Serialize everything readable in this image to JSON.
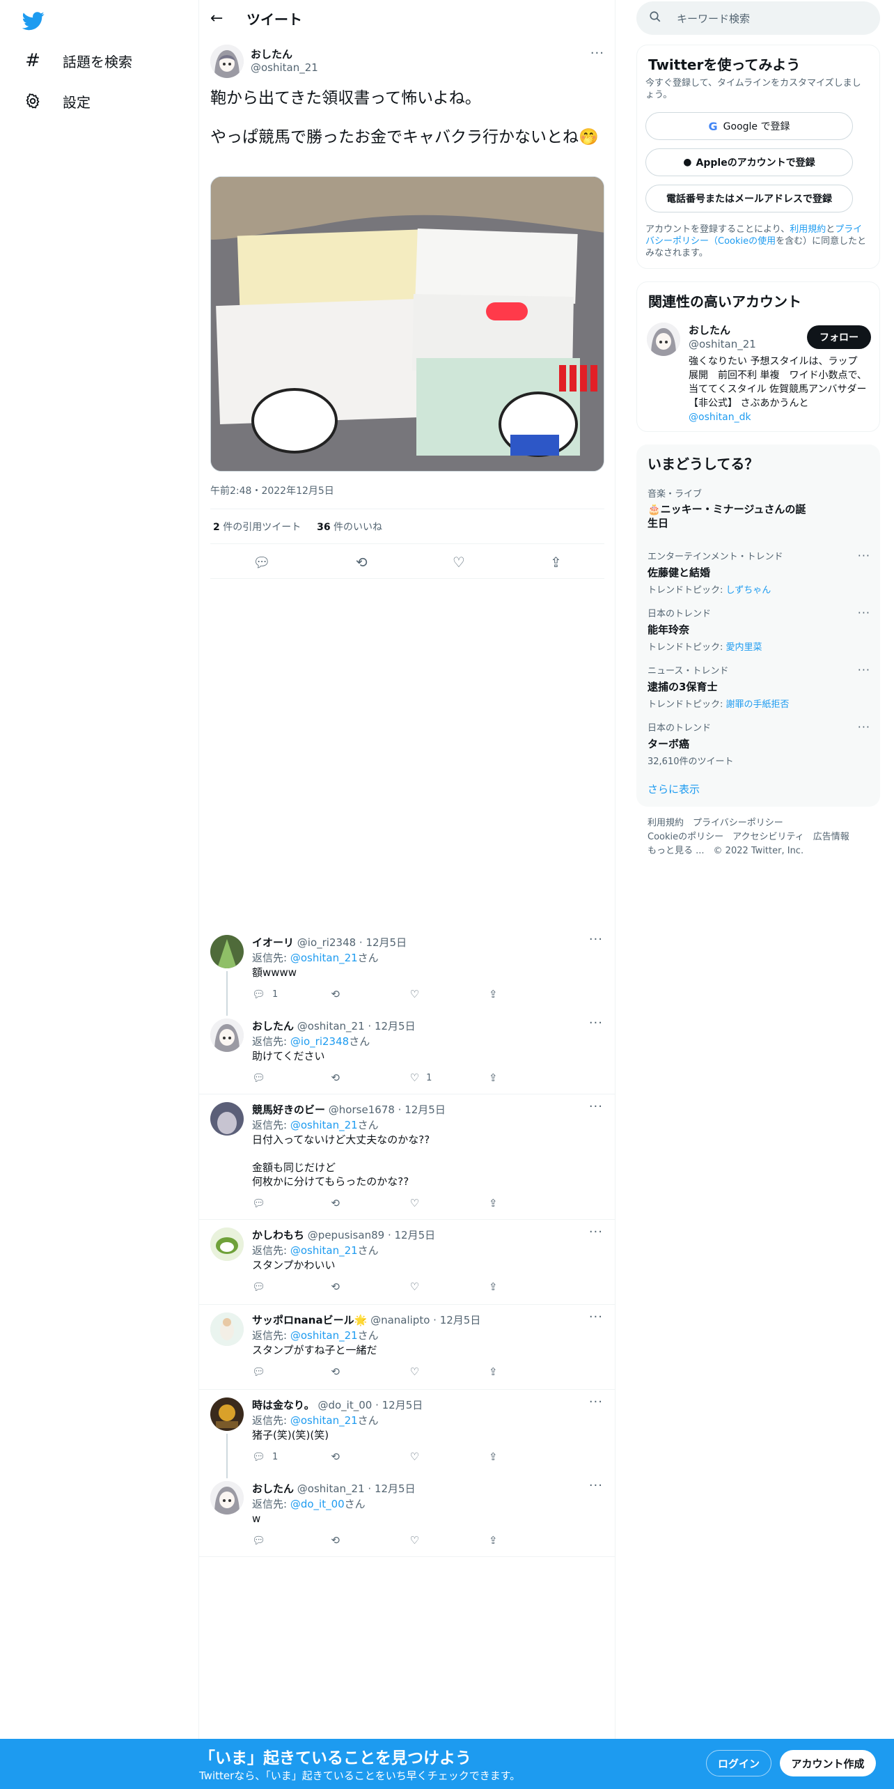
{
  "nav": {
    "logo": "twitter-bird",
    "items": [
      {
        "label": "話題を検索",
        "icon": "hashtag-icon"
      },
      {
        "label": "設定",
        "icon": "gear-icon"
      }
    ]
  },
  "header": {
    "title": "ツイート"
  },
  "tweet": {
    "name": "おしたん",
    "handle": "@oshitan_21",
    "text1": "鞄から出てきた領収書って怖いよね。",
    "text2": "やっぱ競馬で勝ったお金でキャバクラ行かないとね🤭",
    "timestamp": "午前2:48・2022年12月5日",
    "quote_count": "2",
    "quote_label": "件の引用ツイート",
    "like_count": "36",
    "like_label": "件のいいね"
  },
  "replies": [
    {
      "name": "イオーリ",
      "handle": "@io_ri2348",
      "date": "12月5日",
      "to_prefix": "返信先: ",
      "to": "@oshitan_21",
      "to_suffix": "さん",
      "text": "額wwww",
      "reply_count": "1",
      "retweet_count": "",
      "like_count": ""
    },
    {
      "name": "おしたん",
      "handle": "@oshitan_21",
      "date": "12月5日",
      "to_prefix": "返信先: ",
      "to": "@io_ri2348",
      "to_suffix": "さん",
      "text": "助けてください",
      "reply_count": "",
      "retweet_count": "",
      "like_count": "1"
    },
    {
      "name": "競馬好きのビー",
      "handle": "@horse1678",
      "date": "12月5日",
      "to_prefix": "返信先: ",
      "to": "@oshitan_21",
      "to_suffix": "さん",
      "text": "日付入ってないけど大丈夫なのかな??",
      "text2": "金額も同じだけど",
      "text3": "何枚かに分けてもらったのかな??",
      "reply_count": "",
      "retweet_count": "",
      "like_count": ""
    },
    {
      "name": "かしわもち",
      "handle": "@pepusisan89",
      "date": "12月5日",
      "to_prefix": "返信先: ",
      "to": "@oshitan_21",
      "to_suffix": "さん",
      "text": "スタンプかわいい",
      "reply_count": "",
      "retweet_count": "",
      "like_count": ""
    },
    {
      "name": "サッポロnanaビール🌟",
      "handle": "@nanalipto",
      "date": "12月5日",
      "to_prefix": "返信先: ",
      "to": "@oshitan_21",
      "to_suffix": "さん",
      "text": "スタンプがすね子と一緒だ",
      "reply_count": "",
      "retweet_count": "",
      "like_count": ""
    },
    {
      "name": "時は金なり。",
      "handle": "@do_it_00",
      "date": "12月5日",
      "to_prefix": "返信先: ",
      "to": "@oshitan_21",
      "to_suffix": "さん",
      "text": "猪子(笑)(笑)(笑)",
      "reply_count": "1",
      "retweet_count": "",
      "like_count": ""
    },
    {
      "name": "おしたん",
      "handle": "@oshitan_21",
      "date": "12月5日",
      "to_prefix": "返信先: ",
      "to": "@do_it_00",
      "to_suffix": "さん",
      "text": "w",
      "reply_count": "",
      "retweet_count": "",
      "like_count": ""
    }
  ],
  "search": {
    "placeholder": "キーワード検索"
  },
  "signup_box": {
    "title": "Twitterを使ってみよう",
    "subtitle": "今すぐ登録して、タイムラインをカスタマイズしましょう。",
    "google": "Google で登録",
    "apple": "Appleのアカウントで登録",
    "phone": "電話番号またはメールアドレスで登録",
    "terms_a": "アカウントを登録することにより、",
    "terms_link1": "利用規約",
    "terms_b": "と",
    "terms_link2": "プライバシーポリシー（Cookieの使用",
    "terms_c": "を含む）に同意したとみなされます。"
  },
  "related": {
    "title": "関連性の高いアカウント",
    "name": "おしたん",
    "handle": "@oshitan_21",
    "follow": "フォロー",
    "bio": "強くなりたい 予想スタイルは、ラップ　展開　前回不利 単複　ワイド小数点で、当ててくスタイル 佐賀競馬アンバサダー【非公式】 さぶあかうんと",
    "bio_link": "@oshitan_dk"
  },
  "trends": {
    "title": "いまどうしてる？",
    "items": [
      {
        "cat": "音楽・ライブ",
        "name": "🎂ニッキー・ミナージュさんの誕生日",
        "sub_prefix": "",
        "sub_link": ""
      },
      {
        "cat": "エンターテインメント・トレンド",
        "name": "佐藤健と結婚",
        "sub_prefix": "トレンドトピック: ",
        "sub_link": "しずちゃん"
      },
      {
        "cat": "日本のトレンド",
        "name": "能年玲奈",
        "sub_prefix": "トレンドトピック: ",
        "sub_link": "愛内里菜"
      },
      {
        "cat": "ニュース・トレンド",
        "name": "逮捕の3保育士",
        "sub_prefix": "トレンドトピック: ",
        "sub_link": "謝罪の手紙拒否"
      },
      {
        "cat": "日本のトレンド",
        "name": "ターボ癌",
        "sub_prefix": "32,610件のツイート",
        "sub_link": ""
      }
    ],
    "more": "さらに表示"
  },
  "footer": {
    "l1": "利用規約",
    "l2": "プライバシーポリシー",
    "l3": "Cookieのポリシー",
    "l4": "アクセシビリティ",
    "l5": "広告情報",
    "l6": "もっと見る ...",
    "copy": "© 2022 Twitter, Inc."
  },
  "bottom": {
    "title": "「いま」起きていることを見つけよう",
    "sub": "Twitterなら、「いま」起きていることをいち早くチェックできます。",
    "login": "ログイン",
    "signup": "アカウント作成"
  },
  "colors": {
    "accent": "#1d9bf0",
    "text": "#0f1419",
    "muted": "#536471"
  }
}
